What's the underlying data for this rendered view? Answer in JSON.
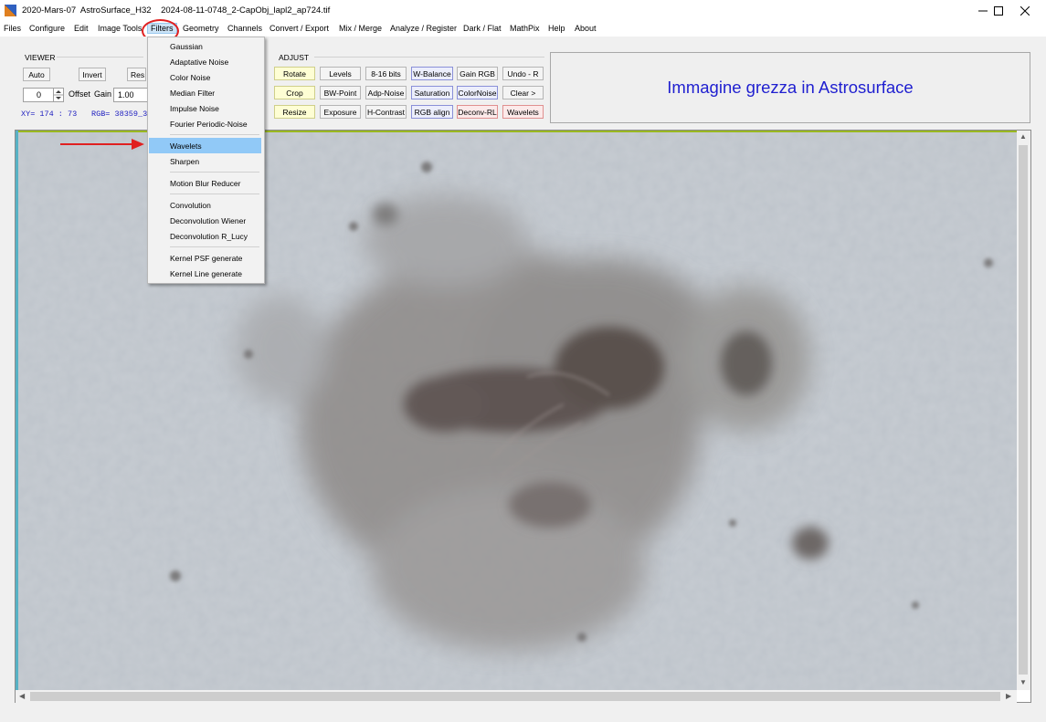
{
  "window": {
    "title": "2020-Mars-07  AstroSurface_H32    2024-08-11-0748_2-CapObj_lapl2_ap724.tif",
    "controls": [
      "minimize",
      "maximize",
      "close"
    ]
  },
  "menu": {
    "files": "Files",
    "configure": "Configure",
    "edit": "Edit",
    "image_tools": "Image Tools",
    "filters": "Filters",
    "geometry": "Geometry",
    "channels": "Channels",
    "convert_export": "Convert / Export",
    "mix_merge": "Mix / Merge",
    "analyze_register": "Analyze / Register",
    "dark_flat": "Dark / Flat",
    "mathpix": "MathPix",
    "help": "Help",
    "about": "About"
  },
  "filters_menu": {
    "items": [
      "Gaussian",
      "Adaptative Noise",
      "Color Noise",
      "Median Filter",
      "Impulse Noise",
      "Fourier Periodic-Noise",
      "Wavelets",
      "Sharpen",
      "Motion Blur Reducer",
      "Convolution",
      "Deconvolution Wiener",
      "Deconvolution R_Lucy",
      "Kernel PSF generate",
      "Kernel Line generate"
    ],
    "highlighted": "Wavelets"
  },
  "viewer": {
    "label": "VIEWER",
    "auto": "Auto",
    "invert": "Invert",
    "reset": "Res",
    "offset_value": "0",
    "offset_label": "Offset",
    "gain_label": "Gain",
    "gain_value": "1.00",
    "xy_readout": "XY=  174 : 73",
    "rgb_readout": "RGB=  38359_3"
  },
  "adjust": {
    "label": "ADJUST",
    "row1": [
      "Rotate",
      "Levels",
      "8-16 bits",
      "W-Balance",
      "Gain RGB",
      "Undo - R"
    ],
    "row2": [
      "Crop",
      "BW-Point",
      "Adp-Noise",
      "Saturation",
      "ColorNoise",
      "Clear >"
    ],
    "row3": [
      "Resize",
      "Exposure",
      "H-Contrast",
      "RGB align",
      "Deconv-RL",
      "Wavelets"
    ]
  },
  "caption": "Immagine grezza in Astrosurface",
  "colors": {
    "caption_text": "#1f1fd0",
    "annotation_red": "#e02020",
    "menu_highlight": "#91c9f7",
    "readout_blue": "#2020c0"
  }
}
